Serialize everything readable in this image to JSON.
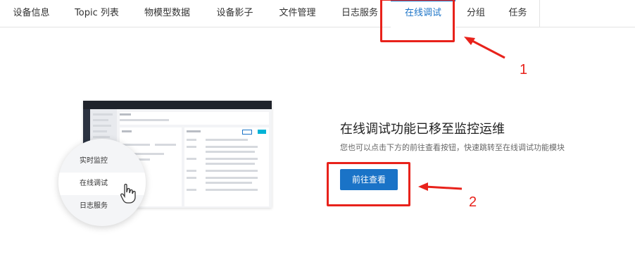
{
  "tabs": [
    {
      "label": "设备信息"
    },
    {
      "label": "Topic 列表"
    },
    {
      "label": "物模型数据"
    },
    {
      "label": "设备影子"
    },
    {
      "label": "文件管理"
    },
    {
      "label": "日志服务"
    },
    {
      "label": "在线调试",
      "active": true
    },
    {
      "label": "分组"
    },
    {
      "label": "任务"
    }
  ],
  "illustration_menu": {
    "items": [
      "实时监控",
      "在线调试",
      "日志服务"
    ],
    "highlighted": "在线调试"
  },
  "main": {
    "title": "在线调试功能已移至监控运维",
    "subtitle": "您也可以点击下方的前往查看按钮，快速跳转至在线调试功能模块",
    "button_label": "前往查看"
  },
  "annotations": {
    "marker_1": "1",
    "marker_2": "2",
    "color": "#e8221b"
  },
  "colors": {
    "accent": "#1a73c7"
  }
}
